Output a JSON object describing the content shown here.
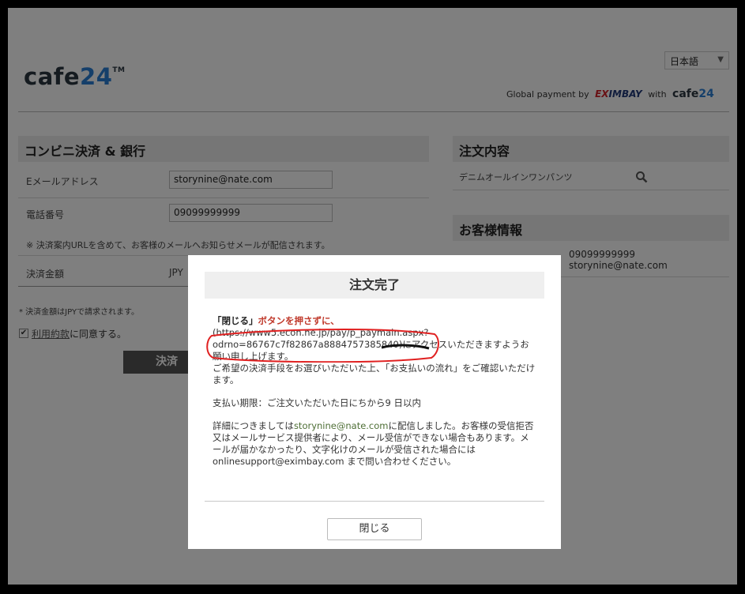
{
  "header": {
    "logo_text": "cafe",
    "logo_num": "24",
    "logo_tm": "TM",
    "language": "日本語",
    "global_payment_prefix": "Global payment by",
    "eximbay_e": "E",
    "eximbay_x": "X",
    "eximbay_rest": "IMBAY",
    "with": "with",
    "cafe24_small_text": "cafe",
    "cafe24_small_num": "24"
  },
  "payment_section": {
    "title": "コンビニ決済 & 銀行",
    "email_label": "Eメールアドレス",
    "email_value": "storynine@nate.com",
    "phone_label": "電話番号",
    "phone_value": "09099999999",
    "notice": "※ 決済案内URLを含めて、お客様のメールへお知らせメールが配信されます。",
    "amount_label": "決済金額",
    "amount_currency": "JPY",
    "jpy_note": "* 決済金額はJPYで請求されます。",
    "terms_link": "利用約款",
    "terms_suffix": "に同意する。",
    "pay_button": "決済"
  },
  "order_section": {
    "title": "注文内容",
    "item_name": "デニムオールインワンパンツ"
  },
  "customer_section": {
    "title": "お客様情報",
    "phone": "09099999999",
    "email": "storynine@nate.com"
  },
  "modal": {
    "title": "注文完了",
    "close_quote": "「閉じる」",
    "close_instruction": "ボタンを押さずに、",
    "url_line1": "(https://www5.econ.ne.jp/pay/p_paymain.aspx?",
    "url_line2": "odrno=86767c7f82867a8884757385840",
    "access_text": ")にアクセスいただきますようお願い申し上げます。",
    "confirm_text": "ご希望の決済手段をお選びいただいた上、「お支払いの流れ」をご確認いただけます。",
    "deadline": "支払い期限：ご注文いただいた日にちから9 日以内",
    "detail_prefix": "詳細につきましては",
    "detail_email": "storynine@nate.com",
    "detail_suffix": "に配信しました。お客様の受信拒否又はメールサービス提供者により、メール受信ができない場合もあります。メールが届かなかったり、文字化けのメールが受信された場合には",
    "support_email": "onlinesupport@eximbay.com",
    "support_suffix": " まで問い合わせください。",
    "close_button": "閉じる"
  },
  "colors": {
    "overlay": "#7f7f7f",
    "accent_red": "#c0392b",
    "logo_dark": "#2b3640",
    "logo_blue": "#2a7fd4"
  }
}
